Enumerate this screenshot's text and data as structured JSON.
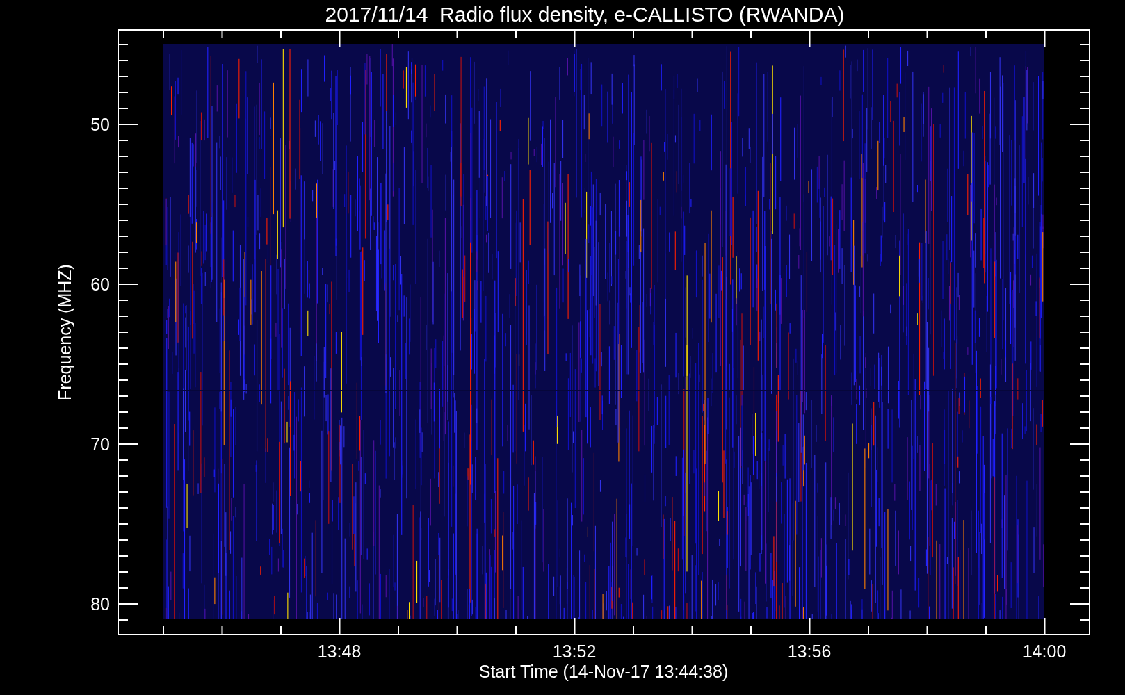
{
  "title": "2017/11/14  Radio flux density, e-CALLISTO (RWANDA)",
  "plot": {
    "ylabel": "Frequency (MHZ)",
    "xlabel": "Start Time (14-Nov-17 13:44:38)",
    "yticks": [
      "50",
      "60",
      "70",
      "80"
    ],
    "xticks": [
      "13:48",
      "13:52",
      "13:56",
      "14:00"
    ]
  }
}
